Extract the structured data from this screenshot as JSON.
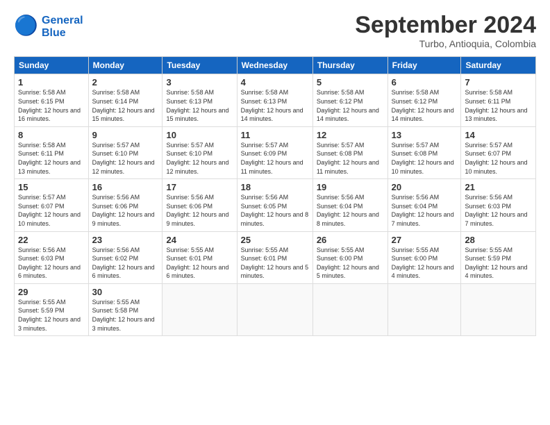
{
  "logo": {
    "line1": "General",
    "line2": "Blue"
  },
  "title": "September 2024",
  "subtitle": "Turbo, Antioquia, Colombia",
  "headers": [
    "Sunday",
    "Monday",
    "Tuesday",
    "Wednesday",
    "Thursday",
    "Friday",
    "Saturday"
  ],
  "weeks": [
    [
      {
        "day": "1",
        "sunrise": "5:58 AM",
        "sunset": "6:15 PM",
        "daylight": "12 hours and 16 minutes."
      },
      {
        "day": "2",
        "sunrise": "5:58 AM",
        "sunset": "6:14 PM",
        "daylight": "12 hours and 15 minutes."
      },
      {
        "day": "3",
        "sunrise": "5:58 AM",
        "sunset": "6:13 PM",
        "daylight": "12 hours and 15 minutes."
      },
      {
        "day": "4",
        "sunrise": "5:58 AM",
        "sunset": "6:13 PM",
        "daylight": "12 hours and 14 minutes."
      },
      {
        "day": "5",
        "sunrise": "5:58 AM",
        "sunset": "6:12 PM",
        "daylight": "12 hours and 14 minutes."
      },
      {
        "day": "6",
        "sunrise": "5:58 AM",
        "sunset": "6:12 PM",
        "daylight": "12 hours and 14 minutes."
      },
      {
        "day": "7",
        "sunrise": "5:58 AM",
        "sunset": "6:11 PM",
        "daylight": "12 hours and 13 minutes."
      }
    ],
    [
      {
        "day": "8",
        "sunrise": "5:58 AM",
        "sunset": "6:11 PM",
        "daylight": "12 hours and 13 minutes."
      },
      {
        "day": "9",
        "sunrise": "5:57 AM",
        "sunset": "6:10 PM",
        "daylight": "12 hours and 12 minutes."
      },
      {
        "day": "10",
        "sunrise": "5:57 AM",
        "sunset": "6:10 PM",
        "daylight": "12 hours and 12 minutes."
      },
      {
        "day": "11",
        "sunrise": "5:57 AM",
        "sunset": "6:09 PM",
        "daylight": "12 hours and 11 minutes."
      },
      {
        "day": "12",
        "sunrise": "5:57 AM",
        "sunset": "6:08 PM",
        "daylight": "12 hours and 11 minutes."
      },
      {
        "day": "13",
        "sunrise": "5:57 AM",
        "sunset": "6:08 PM",
        "daylight": "12 hours and 10 minutes."
      },
      {
        "day": "14",
        "sunrise": "5:57 AM",
        "sunset": "6:07 PM",
        "daylight": "12 hours and 10 minutes."
      }
    ],
    [
      {
        "day": "15",
        "sunrise": "5:57 AM",
        "sunset": "6:07 PM",
        "daylight": "12 hours and 10 minutes."
      },
      {
        "day": "16",
        "sunrise": "5:56 AM",
        "sunset": "6:06 PM",
        "daylight": "12 hours and 9 minutes."
      },
      {
        "day": "17",
        "sunrise": "5:56 AM",
        "sunset": "6:06 PM",
        "daylight": "12 hours and 9 minutes."
      },
      {
        "day": "18",
        "sunrise": "5:56 AM",
        "sunset": "6:05 PM",
        "daylight": "12 hours and 8 minutes."
      },
      {
        "day": "19",
        "sunrise": "5:56 AM",
        "sunset": "6:04 PM",
        "daylight": "12 hours and 8 minutes."
      },
      {
        "day": "20",
        "sunrise": "5:56 AM",
        "sunset": "6:04 PM",
        "daylight": "12 hours and 7 minutes."
      },
      {
        "day": "21",
        "sunrise": "5:56 AM",
        "sunset": "6:03 PM",
        "daylight": "12 hours and 7 minutes."
      }
    ],
    [
      {
        "day": "22",
        "sunrise": "5:56 AM",
        "sunset": "6:03 PM",
        "daylight": "12 hours and 6 minutes."
      },
      {
        "day": "23",
        "sunrise": "5:56 AM",
        "sunset": "6:02 PM",
        "daylight": "12 hours and 6 minutes."
      },
      {
        "day": "24",
        "sunrise": "5:55 AM",
        "sunset": "6:01 PM",
        "daylight": "12 hours and 6 minutes."
      },
      {
        "day": "25",
        "sunrise": "5:55 AM",
        "sunset": "6:01 PM",
        "daylight": "12 hours and 5 minutes."
      },
      {
        "day": "26",
        "sunrise": "5:55 AM",
        "sunset": "6:00 PM",
        "daylight": "12 hours and 5 minutes."
      },
      {
        "day": "27",
        "sunrise": "5:55 AM",
        "sunset": "6:00 PM",
        "daylight": "12 hours and 4 minutes."
      },
      {
        "day": "28",
        "sunrise": "5:55 AM",
        "sunset": "5:59 PM",
        "daylight": "12 hours and 4 minutes."
      }
    ],
    [
      {
        "day": "29",
        "sunrise": "5:55 AM",
        "sunset": "5:59 PM",
        "daylight": "12 hours and 3 minutes."
      },
      {
        "day": "30",
        "sunrise": "5:55 AM",
        "sunset": "5:58 PM",
        "daylight": "12 hours and 3 minutes."
      },
      null,
      null,
      null,
      null,
      null
    ]
  ]
}
